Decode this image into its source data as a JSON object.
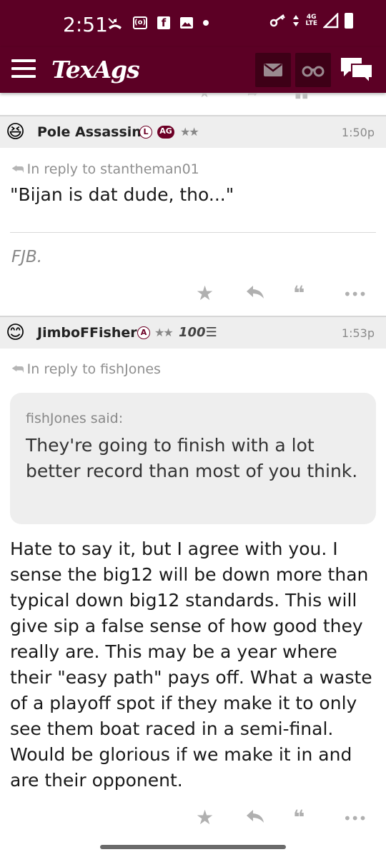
{
  "status_bar": {
    "time": "2:51",
    "network_label": "4G",
    "network_sub": "LTE",
    "left_icons": [
      "missed-call-icon",
      "radio-icon",
      "facebook-icon",
      "image-icon",
      "dot-icon"
    ],
    "right_icons": [
      "key-icon",
      "data-arrows-icon",
      "signal-icon",
      "battery-icon"
    ]
  },
  "header": {
    "logo": "TexAgs",
    "brand_color": "#5c0025",
    "buttons": [
      "mail-icon",
      "binoculars-icon",
      "chat-icon"
    ]
  },
  "posts": [
    {
      "username": "Pole Assassin",
      "avatar": "laughing-emoji-avatar",
      "badges": [
        "L",
        "AG"
      ],
      "stars": "★★",
      "time": "1:50p",
      "reply_to": "In reply to stantheman01",
      "body": "\"Bijan is dat dude, tho...\"",
      "signature": "FJB."
    },
    {
      "username": "JimboFFisher",
      "avatar": "smiling-emoji-avatar",
      "badges": [
        "A"
      ],
      "stars": "★★",
      "hundred": "100",
      "time": "1:53p",
      "reply_to": "In reply to fishJones",
      "quote": {
        "by": "fishJones said:",
        "text": "They're going to finish with a lot better record than most of you think."
      },
      "body": "Hate to say it, but I agree with you. I sense the big12 will be down more than typical down big12 standards. This will give sip a false sense of how good they really are. This may be a year where their \"easy path\" pays off. What a waste of a playoff spot if they make it to only see them boat raced in a semi-final. Would be glorious if we make it in and are their opponent."
    }
  ],
  "actions": {
    "star": "★",
    "reply": "reply-icon",
    "quote": "❝",
    "more": "•••"
  }
}
